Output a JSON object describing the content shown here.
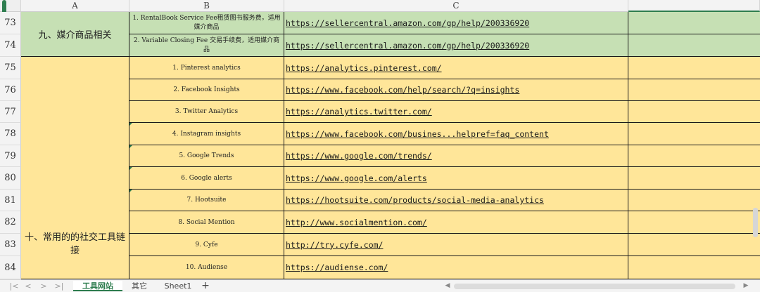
{
  "columns": [
    "A",
    "B",
    "C",
    ""
  ],
  "row_numbers": [
    "73",
    "74",
    "75",
    "76",
    "77",
    "78",
    "79",
    "80",
    "81",
    "82",
    "83",
    "84"
  ],
  "group_media": "九、媒介商品相关",
  "group_social": "十、常用的的社交工具链接",
  "rows": [
    {
      "b": "1. RentalBook Service Fee租赁图书服务费，适用媒介商品",
      "c": "https://sellercentral.amazon.com/gp/help/200336920"
    },
    {
      "b": "2. Variable Closing Fee 交易手续费，适用媒介商品",
      "c": "https://sellercentral.amazon.com/gp/help/200336920"
    },
    {
      "b": "1. Pinterest analytics",
      "c": "https://analytics.pinterest.com/"
    },
    {
      "b": "2. Facebook Insights",
      "c": "https://www.facebook.com/help/search/?q=insights"
    },
    {
      "b": "3. Twitter Analytics",
      "c": "https://analytics.twitter.com/"
    },
    {
      "b": "4. Instagram insights",
      "c": "https://www.facebook.com/busines...helpref=faq_content"
    },
    {
      "b": "5. Google Trends",
      "c": "https://www.google.com/trends/"
    },
    {
      "b": "6. Google alerts",
      "c": "https://www.google.com/alerts"
    },
    {
      "b": "7. Hootsuite",
      "c": "https://hootsuite.com/products/social-media-analytics"
    },
    {
      "b": "8. Social Mention",
      "c": "http://www.socialmention.com/"
    },
    {
      "b": "9. Cyfe",
      "c": "http://try.cyfe.com/"
    },
    {
      "b": "10. Audiense",
      "c": "https://audiense.com/"
    }
  ],
  "tabs": [
    "工具网站",
    "其它",
    "Sheet1"
  ],
  "add_sheet": "+",
  "nav": [
    "|<",
    "<",
    ">",
    ">|"
  ],
  "colors": {
    "green_fill": "#c6e0b4",
    "yellow_fill": "#ffe699",
    "accent": "#2e7d4f"
  }
}
